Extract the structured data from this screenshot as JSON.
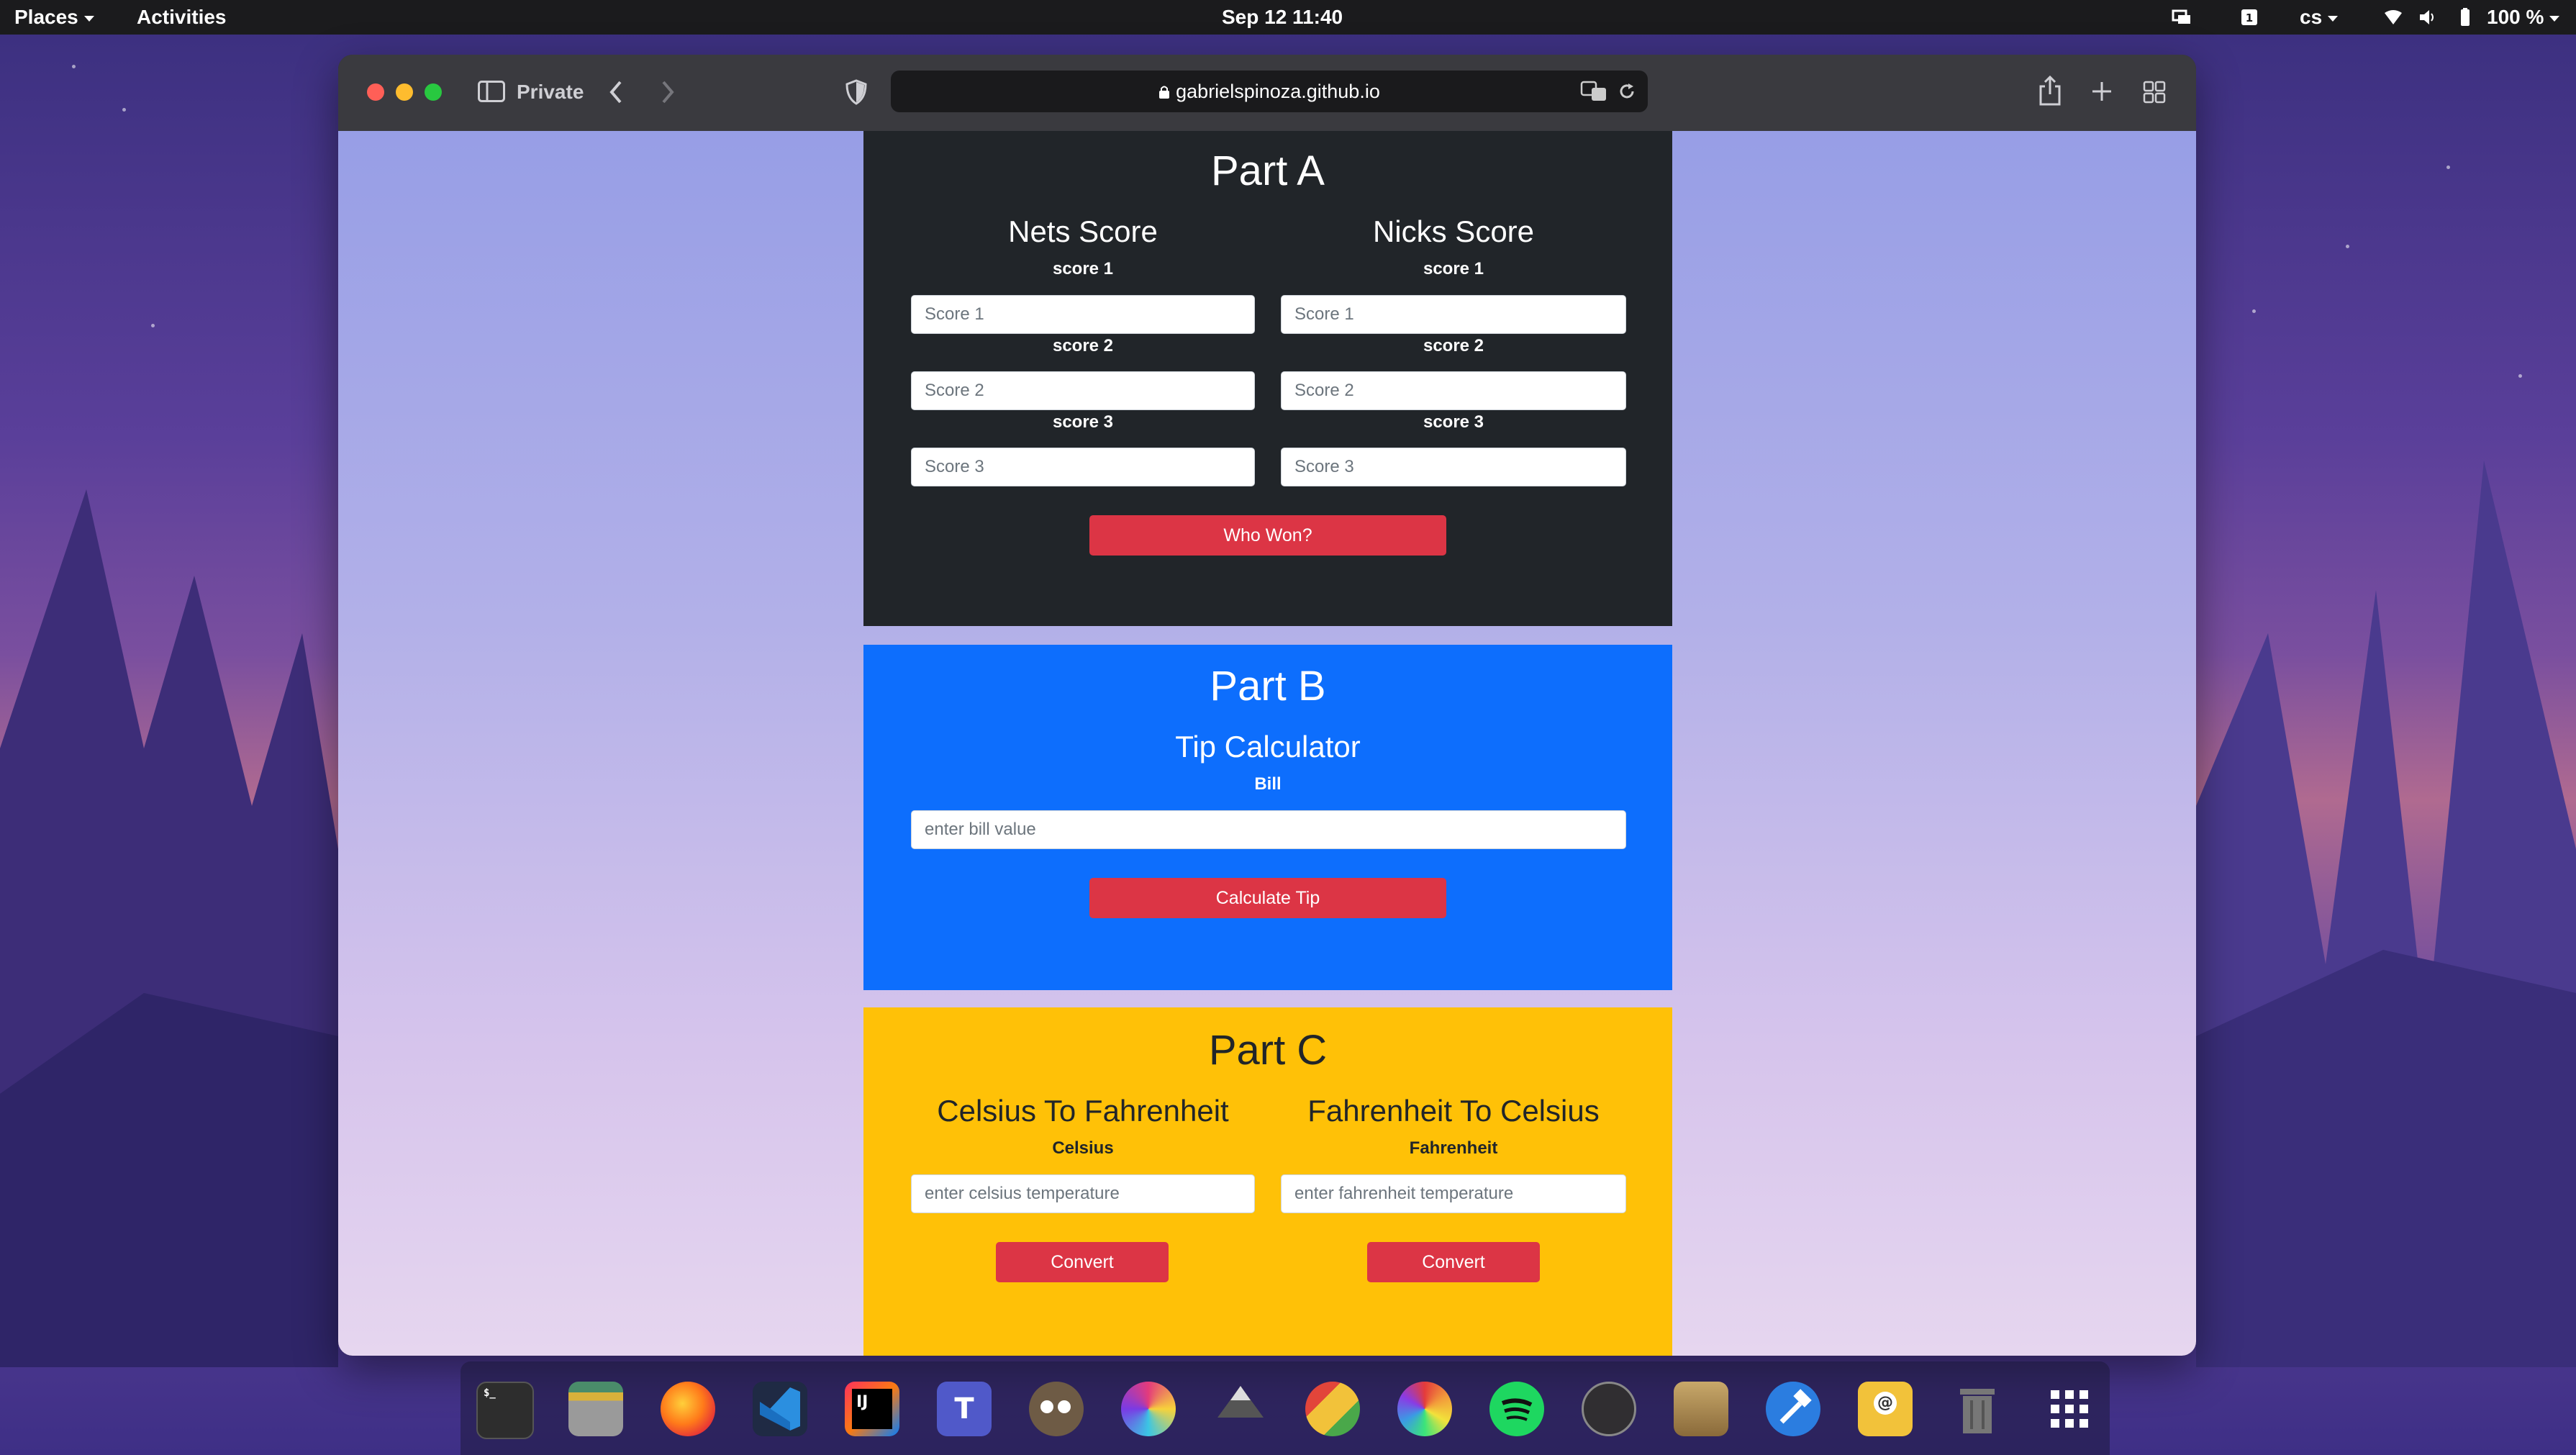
{
  "topbar": {
    "places": "Places",
    "activities": "Activities",
    "clock": "Sep 12  11:40",
    "keyboard_layout": "cs",
    "battery": "100 %"
  },
  "browser": {
    "private_label": "Private",
    "url": "gabrielspinoza.github.io"
  },
  "part_a": {
    "title": "Part A",
    "teams": [
      {
        "heading": "Nets Score",
        "fields": [
          {
            "label": "score 1",
            "placeholder": "Score 1",
            "value": ""
          },
          {
            "label": "score 2",
            "placeholder": "Score 2",
            "value": ""
          },
          {
            "label": "score 3",
            "placeholder": "Score 3",
            "value": ""
          }
        ]
      },
      {
        "heading": "Nicks Score",
        "fields": [
          {
            "label": "score 1",
            "placeholder": "Score 1",
            "value": ""
          },
          {
            "label": "score 2",
            "placeholder": "Score 2",
            "value": ""
          },
          {
            "label": "score 3",
            "placeholder": "Score 3",
            "value": ""
          }
        ]
      }
    ],
    "button": "Who Won?"
  },
  "part_b": {
    "title": "Part B",
    "heading": "Tip Calculator",
    "label": "Bill",
    "placeholder": "enter bill value",
    "button": "Calculate Tip"
  },
  "part_c": {
    "title": "Part C",
    "converters": [
      {
        "heading": "Celsius To Fahrenheit",
        "label": "Celsius",
        "placeholder": "enter celsius temperature",
        "button": "Convert"
      },
      {
        "heading": "Fahrenheit To Celsius",
        "label": "Fahrenheit",
        "placeholder": "enter fahrenheit temperature",
        "button": "Convert"
      }
    ]
  },
  "colors": {
    "part_a_bg": "#212529",
    "part_b_bg": "#0d6efd",
    "part_c_bg": "#ffc107",
    "button_red": "#dc3545"
  },
  "dock": {
    "apps": [
      "terminal-icon",
      "files-icon",
      "firefox-icon",
      "vscode-icon",
      "intellij-icon",
      "teams-icon",
      "gimp-icon",
      "krita-icon",
      "inkscape-icon",
      "color-picker-icon",
      "aperture-icon",
      "spotify-icon",
      "obs-icon",
      "app-installer-icon",
      "build-tools-icon",
      "mail-icon",
      "trash-icon",
      "app-grid-icon"
    ]
  }
}
